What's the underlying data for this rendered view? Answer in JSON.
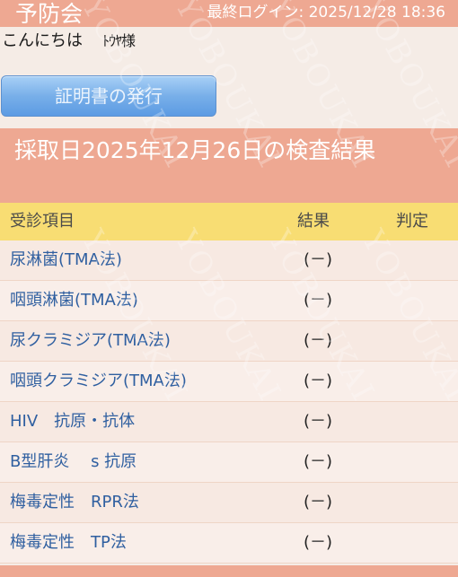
{
  "header": {
    "brand": "予防会",
    "last_login": "最終ログイン: 2025/12/28 18:36"
  },
  "greeting": {
    "hello": "こんにちは",
    "user_name": "ﾄｳﾔ様"
  },
  "certificate_button": {
    "label": "証明書の発行"
  },
  "section": {
    "title": "採取日2025年12月26日の検査結果"
  },
  "table": {
    "headers": {
      "item": "受診項目",
      "result": "結果",
      "judgement": "判定"
    },
    "rows": [
      {
        "item": "尿淋菌(TMA法)",
        "result": "(－)",
        "judgement": ""
      },
      {
        "item": "咽頭淋菌(TMA法)",
        "result": "(－)",
        "judgement": ""
      },
      {
        "item": "尿クラミジア(TMA法)",
        "result": "(－)",
        "judgement": ""
      },
      {
        "item": "咽頭クラミジア(TMA法)",
        "result": "(－)",
        "judgement": ""
      },
      {
        "item": "HIV　抗原・抗体",
        "result": "(－)",
        "judgement": ""
      },
      {
        "item": "B型肝炎　 s 抗原",
        "result": "(－)",
        "judgement": ""
      },
      {
        "item": "梅毒定性　RPR法",
        "result": "(－)",
        "judgement": ""
      },
      {
        "item": "梅毒定性　TP法",
        "result": "(－)",
        "judgement": ""
      }
    ]
  },
  "watermark": {
    "text": "YOBOUKAI"
  },
  "colors": {
    "header_bg": "#eea892",
    "table_header_bg": "#f8dd73",
    "item_text": "#2f5fa0",
    "button_blue": "#78afe9"
  }
}
